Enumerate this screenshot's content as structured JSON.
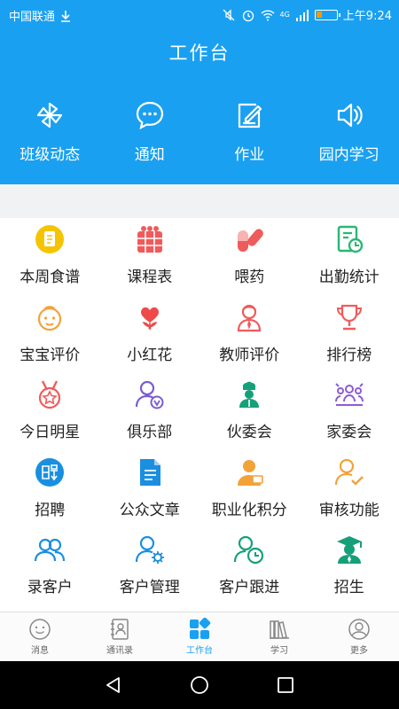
{
  "status": {
    "carrier": "中国联通",
    "time": "上午9:24",
    "network": "4G"
  },
  "page_title": "工作台",
  "quick": [
    {
      "label": "班级动态",
      "icon": "pinwheel-icon"
    },
    {
      "label": "通知",
      "icon": "chat-bubble-icon"
    },
    {
      "label": "作业",
      "icon": "homework-pen-icon"
    },
    {
      "label": "园内学习",
      "icon": "speaker-icon"
    }
  ],
  "grid": [
    {
      "label": "本周食谱",
      "icon": "food-menu-icon",
      "color": "#f5c400"
    },
    {
      "label": "课程表",
      "icon": "schedule-icon",
      "color": "#ef5b5b"
    },
    {
      "label": "喂药",
      "icon": "medicine-capsule-icon",
      "color": "#ef5b5b"
    },
    {
      "label": "出勤统计",
      "icon": "attendance-chart-icon",
      "color": "#2bb673"
    },
    {
      "label": "宝宝评价",
      "icon": "baby-face-icon",
      "color": "#f3a23a"
    },
    {
      "label": "小红花",
      "icon": "red-flower-icon",
      "color": "#ef4a4a"
    },
    {
      "label": "教师评价",
      "icon": "teacher-icon",
      "color": "#ef5b5b"
    },
    {
      "label": "排行榜",
      "icon": "trophy-icon",
      "color": "#ef5b5b"
    },
    {
      "label": "今日明星",
      "icon": "star-medal-icon",
      "color": "#ef5b5b"
    },
    {
      "label": "俱乐部",
      "icon": "club-user-icon",
      "color": "#7a5bd6"
    },
    {
      "label": "伙委会",
      "icon": "chef-icon",
      "color": "#15a07a"
    },
    {
      "label": "家委会",
      "icon": "family-group-icon",
      "color": "#8e5bd6"
    },
    {
      "label": "招聘",
      "icon": "recruit-icon",
      "color": "#1a8fe0"
    },
    {
      "label": "公众文章",
      "icon": "document-icon",
      "color": "#1a8fe0"
    },
    {
      "label": "职业化积分",
      "icon": "career-points-icon",
      "color": "#f3a23a"
    },
    {
      "label": "审核功能",
      "icon": "review-user-icon",
      "color": "#f3a23a"
    },
    {
      "label": "录客户",
      "icon": "add-customer-icon",
      "color": "#1a8fe0"
    },
    {
      "label": "客户管理",
      "icon": "customer-manage-icon",
      "color": "#1a8fe0"
    },
    {
      "label": "客户跟进",
      "icon": "customer-followup-icon",
      "color": "#15a07a"
    },
    {
      "label": "招生",
      "icon": "graduate-icon",
      "color": "#15a07a"
    }
  ],
  "bottom_nav": [
    {
      "label": "消息",
      "icon": "message-face-icon"
    },
    {
      "label": "通讯录",
      "icon": "contacts-book-icon"
    },
    {
      "label": "工作台",
      "icon": "workbench-icon",
      "active": true
    },
    {
      "label": "学习",
      "icon": "books-icon"
    },
    {
      "label": "更多",
      "icon": "person-more-icon"
    }
  ],
  "colors": {
    "header_bg": "#1aa0f0",
    "accent": "#1aa0f0"
  }
}
